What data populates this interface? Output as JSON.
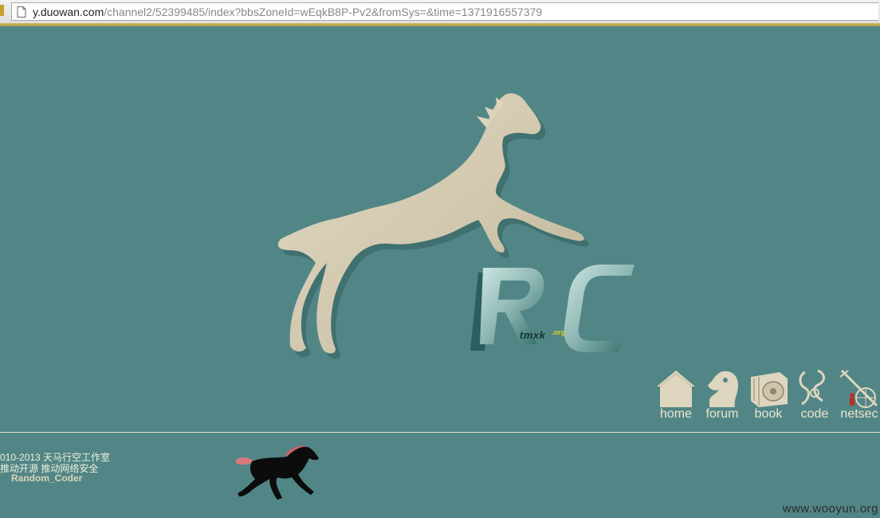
{
  "browser": {
    "url_host": "y.duowan.com",
    "url_path": "/channel2/52399485/index?bbsZoneId=wEqkB8P-Pv2&fromSys=&time=1371916557379"
  },
  "logo": {
    "letters": "RC",
    "sub_text": "tmxk",
    "sub_suffix": ".org"
  },
  "nav": {
    "items": [
      {
        "label": "home",
        "icon": "house-icon"
      },
      {
        "label": "forum",
        "icon": "chess-knight-icon"
      },
      {
        "label": "book",
        "icon": "book-disc-icon"
      },
      {
        "label": "code",
        "icon": "code-glyph-icon"
      },
      {
        "label": "netsec",
        "icon": "sword-globe-icon"
      }
    ]
  },
  "footer": {
    "line1": "010-2013  天马行空工作室",
    "line2": "推动开源    推动网络安全",
    "line3": "Random_Coder"
  },
  "watermark": "www.wooyun.org",
  "colors": {
    "background": "#528686",
    "cream": "#e0d8bf",
    "stripe": "#b8ad4c"
  }
}
